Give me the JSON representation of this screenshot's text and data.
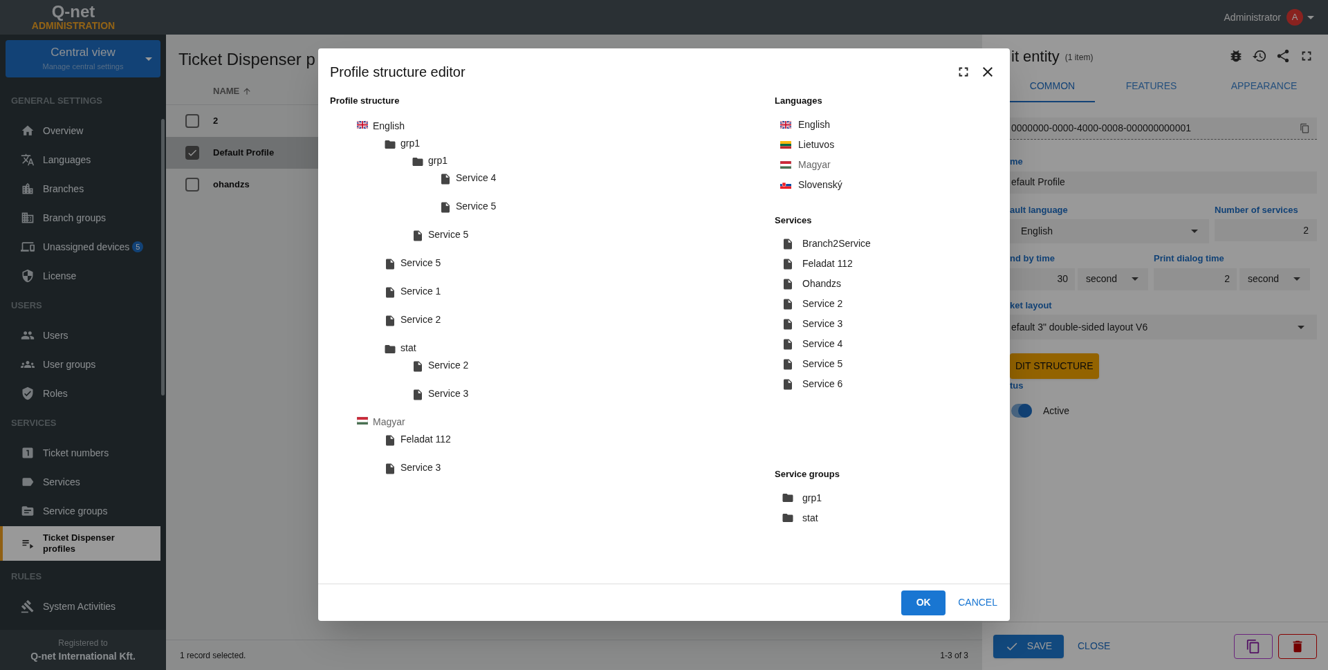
{
  "header": {
    "logo": "Q-net",
    "subtitle": "ADMINISTRATION",
    "user": {
      "name": "Administrator",
      "initial": "A"
    }
  },
  "sidebar": {
    "view_switcher": {
      "title": "Central view",
      "subtitle": "Manage central settings"
    },
    "sections": [
      {
        "title": "GENERAL SETTINGS",
        "items": [
          {
            "label": "Overview",
            "selected": false
          },
          {
            "label": "Languages",
            "selected": false
          },
          {
            "label": "Branches",
            "selected": false
          },
          {
            "label": "Branch groups",
            "selected": false
          },
          {
            "label": "Unassigned devices",
            "badge": "5",
            "selected": false
          },
          {
            "label": "License",
            "selected": false
          }
        ]
      },
      {
        "title": "USERS",
        "items": [
          {
            "label": "Users",
            "selected": false
          },
          {
            "label": "User groups",
            "selected": false
          },
          {
            "label": "Roles",
            "selected": false
          }
        ]
      },
      {
        "title": "SERVICES",
        "items": [
          {
            "label": "Ticket numbers",
            "selected": false
          },
          {
            "label": "Services",
            "selected": false
          },
          {
            "label": "Service groups",
            "selected": false
          },
          {
            "label": "Ticket Dispenser profiles",
            "selected": true
          }
        ]
      },
      {
        "title": "RULES",
        "items": [
          {
            "label": "System Activities",
            "selected": false
          }
        ]
      }
    ],
    "registered": {
      "label": "Registered to",
      "company": "Q-net International Kft."
    }
  },
  "list": {
    "title": "Ticket Dispenser p",
    "column": "NAME",
    "rows": [
      {
        "name": "2",
        "checked": false,
        "selected": false
      },
      {
        "name": "Default Profile",
        "checked": true,
        "selected": true
      },
      {
        "name": "ohandzs",
        "checked": false,
        "selected": false
      }
    ],
    "status": "1 record selected.",
    "pagination": "1-3 of 3"
  },
  "editor": {
    "title": "it entity",
    "count": "(1 item)",
    "tabs": [
      {
        "label": "COMMON",
        "selected": true
      },
      {
        "label": "FEATURES",
        "selected": false
      },
      {
        "label": "APPEARANCE",
        "selected": false
      }
    ],
    "id_value": "0000000-0000-4000-0008-000000000001",
    "name": {
      "label": "me",
      "value": "efault Profile"
    },
    "default_language": {
      "label": "ault language",
      "value": "English"
    },
    "number_of_services": {
      "label": "Number of services",
      "value": "2"
    },
    "send_by_time": {
      "label": "nd by time",
      "value": "30",
      "unit": "second"
    },
    "print_dialog_time": {
      "label": "Print dialog time",
      "value": "2",
      "unit": "second"
    },
    "ticket_layout": {
      "label": "ket layout",
      "value": "efault 3\" double-sided layout V6"
    },
    "edit_structure_button": "DIT STRUCTURE",
    "status": {
      "label": "tus",
      "value": "Active",
      "on": true
    },
    "save_button": "SAVE",
    "close_button": "CLOSE"
  },
  "dialog": {
    "title": "Profile structure editor",
    "structure_heading": "Profile structure",
    "tree": [
      {
        "kind": "language",
        "label": "English",
        "disabled": false,
        "children": [
          {
            "kind": "group",
            "label": "grp1",
            "children": [
              {
                "kind": "group",
                "label": "grp1",
                "children": [
                  {
                    "kind": "service",
                    "label": "Service 4"
                  },
                  {
                    "kind": "service",
                    "label": "Service 5"
                  }
                ]
              },
              {
                "kind": "service",
                "label": "Service 5"
              }
            ]
          },
          {
            "kind": "service",
            "label": "Service 5"
          },
          {
            "kind": "service",
            "label": "Service 1"
          },
          {
            "kind": "service",
            "label": "Service 2"
          },
          {
            "kind": "group",
            "label": "stat",
            "children": [
              {
                "kind": "service",
                "label": "Service 2"
              },
              {
                "kind": "service",
                "label": "Service 3"
              }
            ]
          }
        ]
      },
      {
        "kind": "language",
        "label": "Magyar",
        "disabled": true,
        "children": [
          {
            "kind": "service",
            "label": "Feladat 112"
          },
          {
            "kind": "service",
            "label": "Service 3"
          }
        ]
      }
    ],
    "languages_heading": "Languages",
    "languages": [
      {
        "label": "English",
        "disabled": false
      },
      {
        "label": "Lietuvos",
        "disabled": false
      },
      {
        "label": "Magyar",
        "disabled": true
      },
      {
        "label": "Slovenský",
        "disabled": false
      }
    ],
    "services_heading": "Services",
    "services": [
      "Branch2Service",
      "Feladat 112",
      "Ohandzs",
      "Service 2",
      "Service 3",
      "Service 4",
      "Service 5",
      "Service 6"
    ],
    "service_groups_heading": "Service groups",
    "service_groups": [
      "grp1",
      "stat"
    ],
    "ok_button": "OK",
    "cancel_button": "CANCEL"
  }
}
